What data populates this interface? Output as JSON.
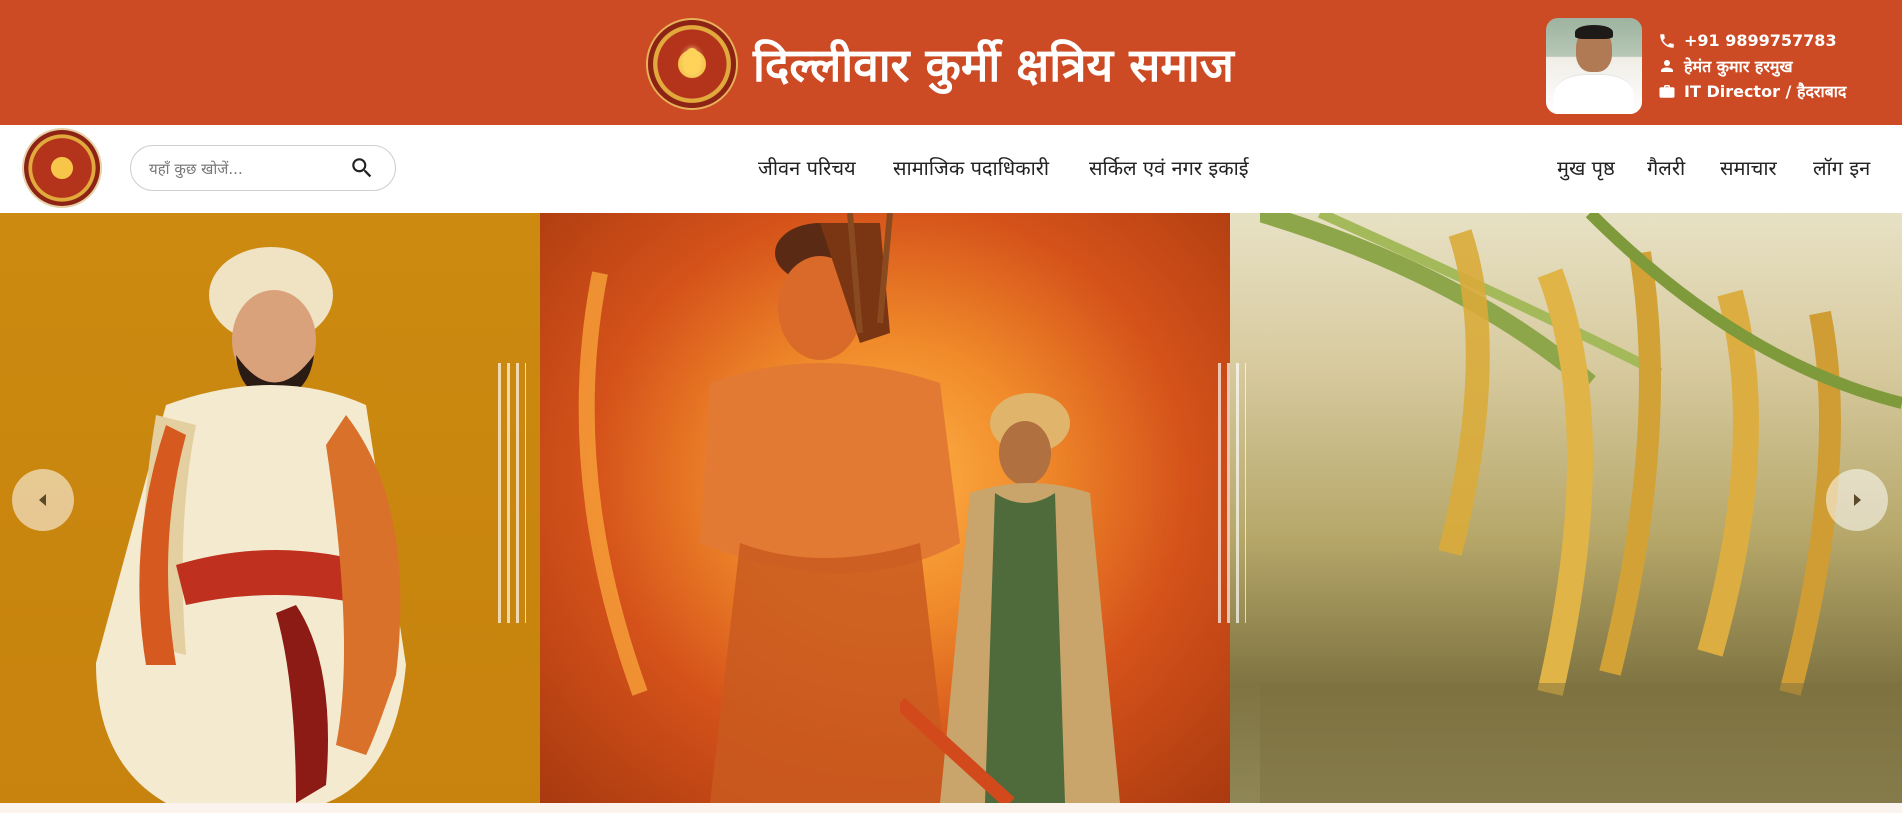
{
  "header": {
    "title": "दिल्लीवार कुर्मी क्षत्रिय समाज",
    "contact": {
      "phone": "+91 9899757783",
      "name": "हेमंत कुमार हरमुख",
      "role": "IT Director / हैदराबाद"
    }
  },
  "nav": {
    "search_placeholder": "यहाँ कुछ खोजें...",
    "center_links": [
      "जीवन परिचय",
      "सामाजिक पदाधिकारी",
      "सर्किल एवं नगर इकाई"
    ],
    "right_links": [
      "मुख पृष्ठ",
      "गैलरी",
      "समाचार",
      "लॉग इन"
    ]
  },
  "icons": {
    "phone": "phone-icon",
    "person": "person-icon",
    "briefcase": "briefcase-icon",
    "search": "search-icon",
    "prev": "chevron-left-icon",
    "next": "chevron-right-icon"
  },
  "colors": {
    "header_bg": "#cd4b24",
    "nav_bg": "#ffffff",
    "text_dark": "#222222",
    "hero_left": "#cc8a10",
    "hero_mid": "#f08a2a"
  }
}
